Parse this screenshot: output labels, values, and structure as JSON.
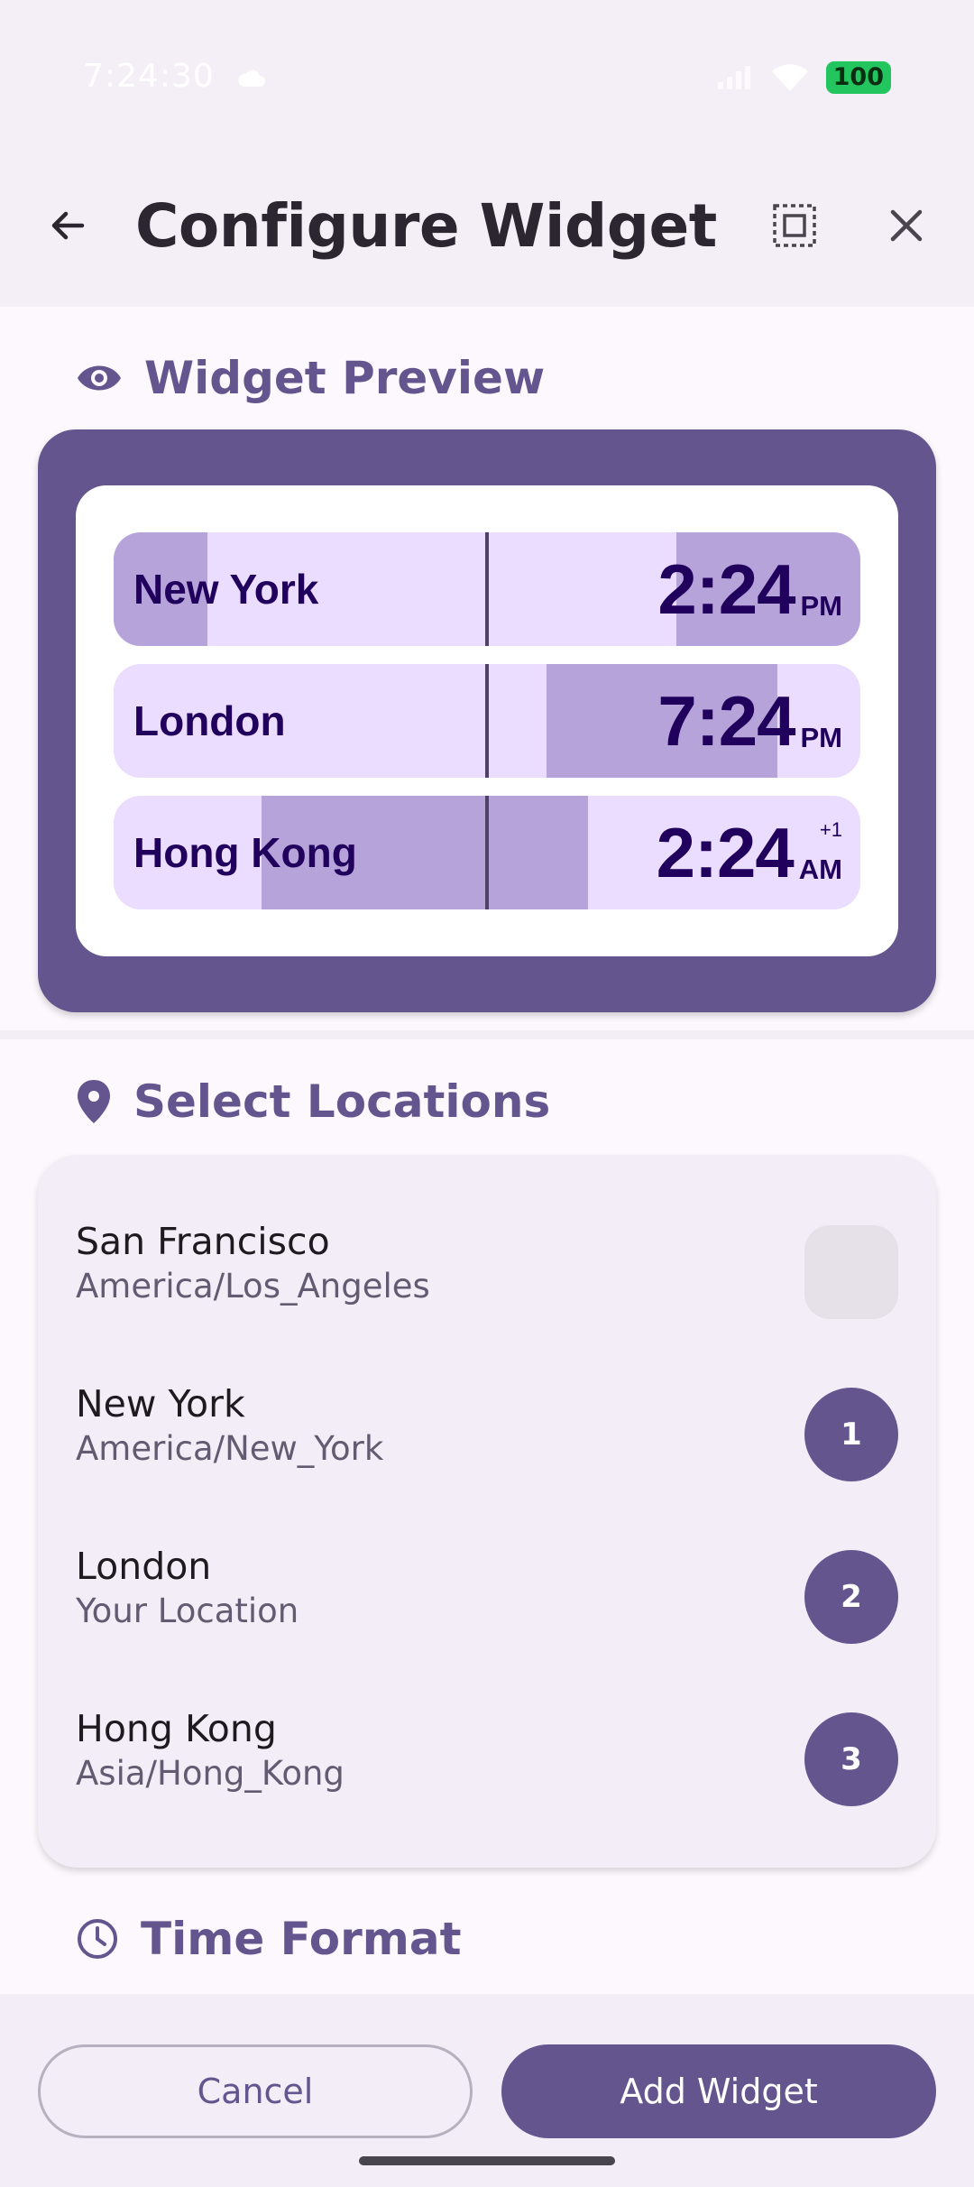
{
  "status_bar": {
    "time": "7:24:30",
    "battery": "100"
  },
  "app_bar": {
    "title": "Configure Widget"
  },
  "preview_section": {
    "heading": "Widget Preview",
    "rows": [
      {
        "city": "New York",
        "time": "2:24",
        "ampm": "PM",
        "day_offset": ""
      },
      {
        "city": "London",
        "time": "7:24",
        "ampm": "PM",
        "day_offset": ""
      },
      {
        "city": "Hong Kong",
        "time": "2:24",
        "ampm": "AM",
        "day_offset": "+1"
      }
    ]
  },
  "locations_section": {
    "heading": "Select Locations",
    "items": [
      {
        "name": "San Francisco",
        "zone": "America/Los_Angeles",
        "order": ""
      },
      {
        "name": "New York",
        "zone": "America/New_York",
        "order": "1"
      },
      {
        "name": "London",
        "zone": "Your Location",
        "order": "2"
      },
      {
        "name": "Hong Kong",
        "zone": "Asia/Hong_Kong",
        "order": "3"
      }
    ]
  },
  "time_format_section": {
    "heading": "Time Format"
  },
  "actions": {
    "cancel_label": "Cancel",
    "add_label": "Add Widget"
  },
  "colors": {
    "primary": "#65558f",
    "row_background": "#eaddff",
    "daylight": "#b6a3da"
  }
}
